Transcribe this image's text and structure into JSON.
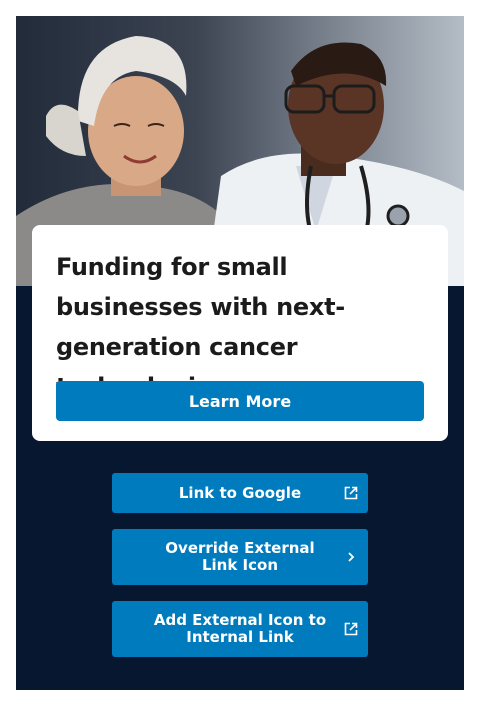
{
  "promo": {
    "title": "Funding for small businesses with next-generation cancer technologies.",
    "button_label": "Learn More"
  },
  "links": [
    {
      "label": "Link to Google",
      "icon": "external-link-icon"
    },
    {
      "label": "Override External Link Icon",
      "icon": "chevron-right-icon"
    },
    {
      "label": "Add External Icon to Internal Link",
      "icon": "external-link-icon"
    }
  ],
  "colors": {
    "accent": "#007bbd",
    "background": "#06172f",
    "text_dark": "#1b1b1b"
  }
}
